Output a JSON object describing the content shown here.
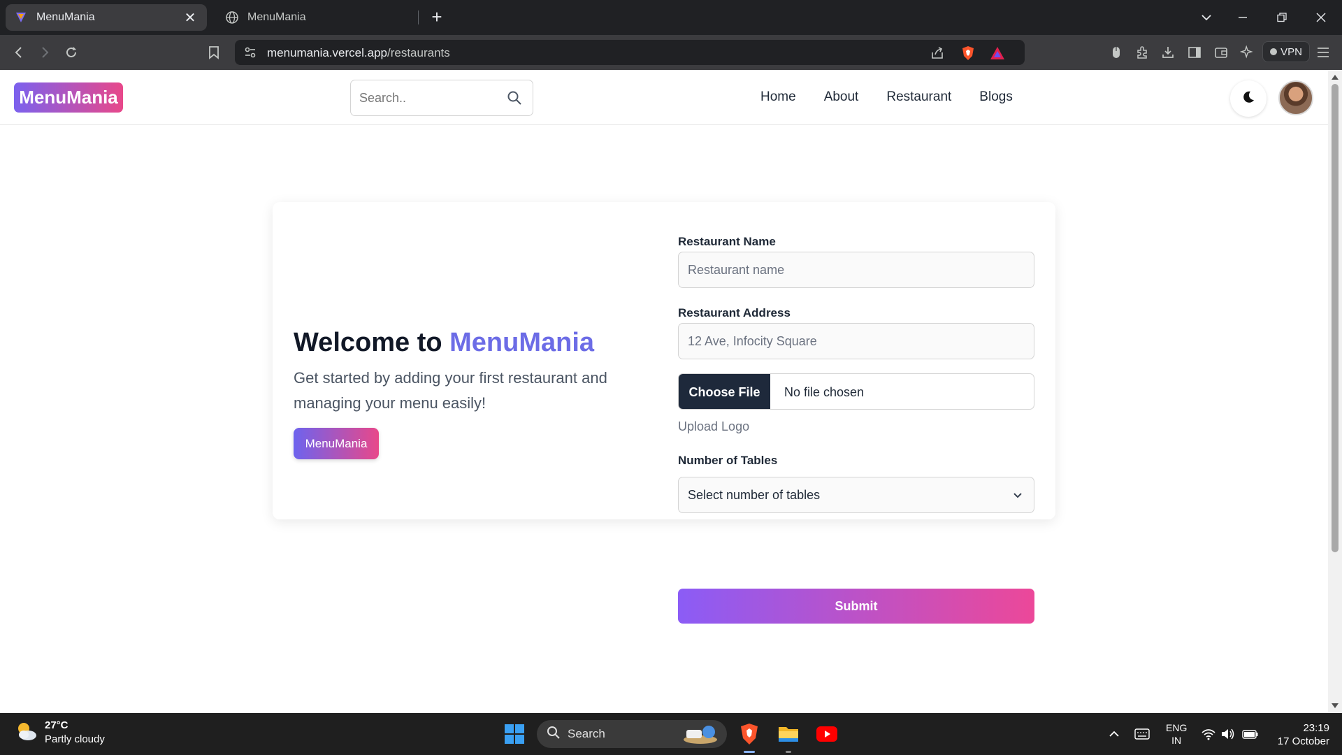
{
  "browser": {
    "tabs": [
      {
        "title": "MenuMania",
        "active": true
      },
      {
        "title": "MenuMania",
        "active": false
      }
    ],
    "url_host": "menumania.vercel.app",
    "url_path": "/restaurants",
    "vpn_label": "VPN"
  },
  "nav": {
    "logo": "MenuMania",
    "search_placeholder": "Search..",
    "links": [
      "Home",
      "About",
      "Restaurant",
      "Blogs"
    ]
  },
  "hero": {
    "welcome_prefix": "Welcome to ",
    "welcome_brand": "MenuMania",
    "subtitle": "Get started by adding your first restaurant and managing your menu easily!",
    "button_label": "MenuMania"
  },
  "form": {
    "name_label": "Restaurant Name",
    "name_placeholder": "Restaurant name",
    "address_label": "Restaurant Address",
    "address_placeholder": "12 Ave, Infocity Square",
    "choose_file_label": "Choose File",
    "no_file_text": "No file chosen",
    "upload_hint": "Upload Logo",
    "tables_label": "Number of Tables",
    "tables_placeholder": "Select number of tables",
    "submit_label": "Submit"
  },
  "taskbar": {
    "temperature": "27°C",
    "weather": "Partly cloudy",
    "search_label": "Search",
    "lang_top": "ENG",
    "lang_bottom": "IN",
    "time": "23:19",
    "date": "17 October"
  },
  "colors": {
    "brand_gradient_start": "#7b61ee",
    "brand_gradient_end": "#e8488a",
    "brand_text": "#6c6ce6",
    "file_button": "#1e293b"
  }
}
